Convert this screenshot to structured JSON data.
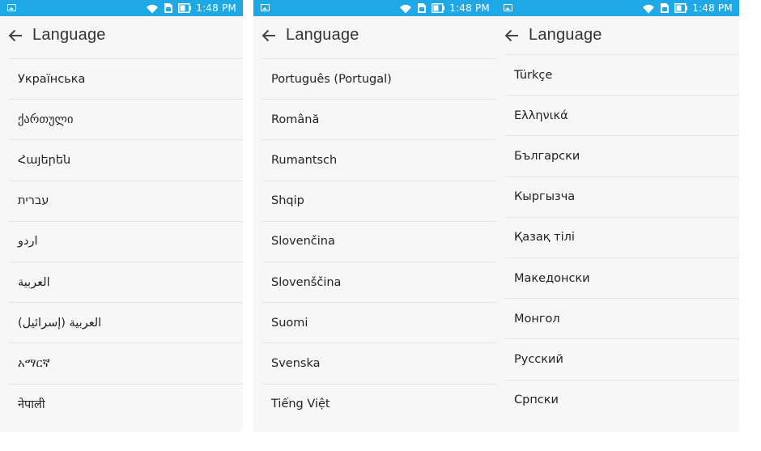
{
  "status_bar": {
    "time": "1:48 PM"
  },
  "screens": [
    {
      "title": "Language",
      "items": [
        "Українська",
        "ქართული",
        "Հայերեն",
        "עברית",
        "اردو",
        "العربية",
        "العربية (إسرائيل)",
        "አማርኛ",
        "नेपाली"
      ]
    },
    {
      "title": "Language",
      "items": [
        "Português (Portugal)",
        "Română",
        "Rumantsch",
        "Shqip",
        "Slovenčina",
        "Slovenščina",
        "Suomi",
        "Svenska",
        "Tiếng Việt"
      ]
    },
    {
      "title": "Language",
      "items": [
        "Türkçe",
        "Ελληνικά",
        "Български",
        "Кыргызча",
        "Қазақ тілі",
        "Македонски",
        "Монгол",
        "Русский",
        "Српски"
      ]
    }
  ]
}
